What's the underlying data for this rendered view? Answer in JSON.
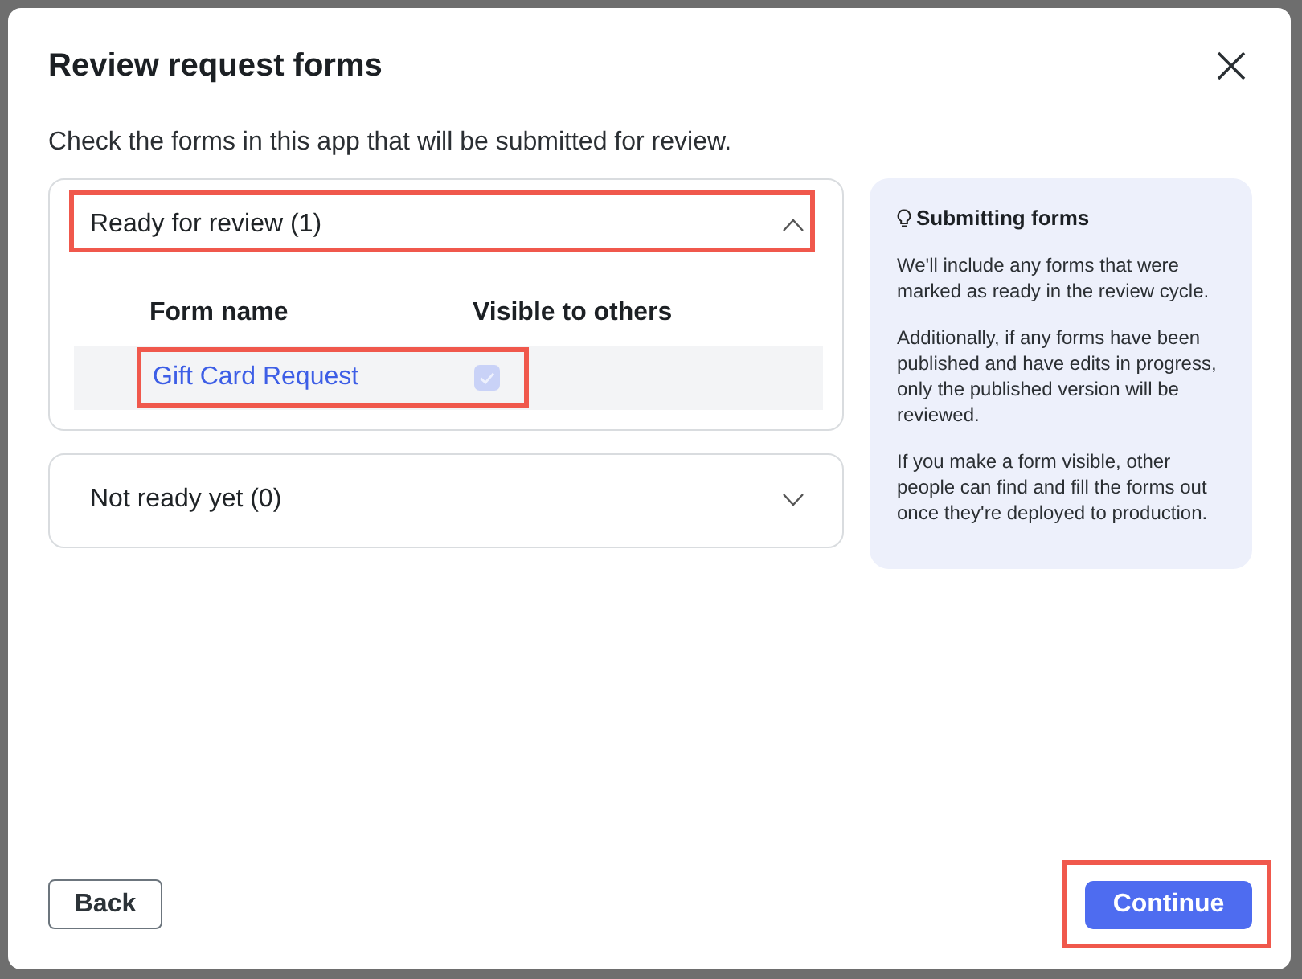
{
  "dialog": {
    "title": "Review request forms",
    "subtitle": "Check the forms in this app that will be submitted for review."
  },
  "sections": [
    {
      "label": "Ready for review (1)",
      "expanded": true,
      "highlighted": true,
      "table": {
        "columns": [
          "Form name",
          "Visible to others"
        ],
        "rows": [
          {
            "form_name": "Gift Card Request",
            "visible_to_others": true,
            "disabled": true,
            "highlighted": true
          }
        ]
      }
    },
    {
      "label": "Not ready yet (0)",
      "expanded": false,
      "highlighted": false
    }
  ],
  "info_panel": {
    "title": "Submitting forms",
    "paragraphs": [
      "We'll include any forms that were marked as ready in the review cycle.",
      "Additionally, if any forms have been published and have edits in progress, only the published version will be reviewed.",
      "If you make a form visible, other people can find and fill the forms out once they're deployed to production."
    ]
  },
  "buttons": [
    {
      "label": "Back",
      "kind": "secondary",
      "highlighted": false
    },
    {
      "label": "Continue",
      "kind": "primary",
      "highlighted": true
    }
  ]
}
